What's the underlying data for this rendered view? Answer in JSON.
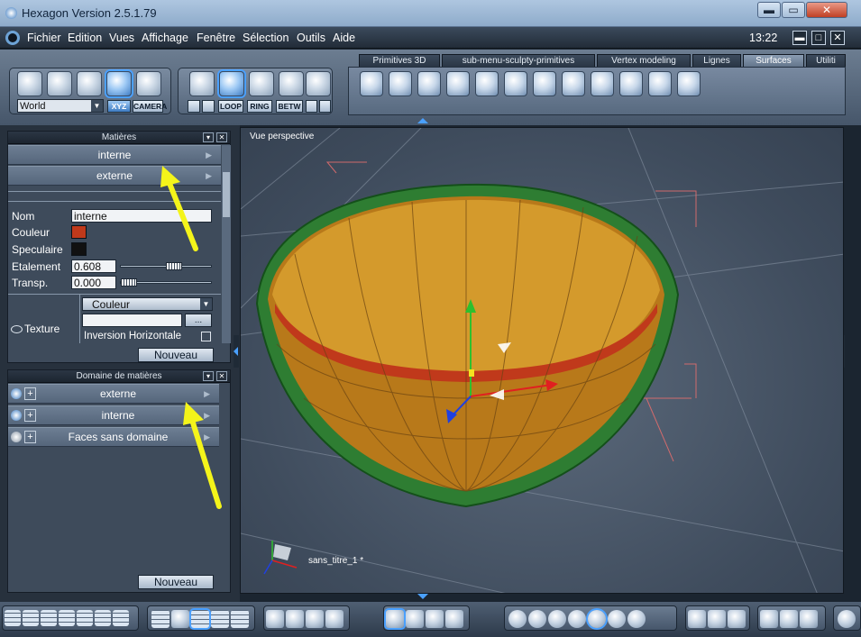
{
  "window": {
    "title": "Hexagon Version 2.5.1.79",
    "min": "▬",
    "max": "▭",
    "close": "✕"
  },
  "menu": {
    "items": [
      "Fichier",
      "Edition",
      "Vues",
      "Affichage",
      "Fenêtre",
      "Sélection",
      "Outils",
      "Aide"
    ],
    "clock": "13:22",
    "btn_min": "▬",
    "btn_max": "□",
    "btn_close": "✕"
  },
  "toolbar": {
    "coord_select": "World",
    "xyz": "XYZ",
    "camera": "CAMERA",
    "mesh_buttons": [
      "LOOP",
      "RING",
      "BETW"
    ]
  },
  "tabs": [
    {
      "label": "Primitives 3D",
      "selected": false
    },
    {
      "label": "sub-menu-sculpty-primitives",
      "selected": false
    },
    {
      "label": "Vertex modeling",
      "selected": false
    },
    {
      "label": "Lignes",
      "selected": false
    },
    {
      "label": "Surfaces",
      "selected": true
    },
    {
      "label": "Utiliti",
      "selected": false
    }
  ],
  "materials_panel": {
    "title": "Matières",
    "rows": [
      "interne",
      "externe"
    ],
    "labels": {
      "name": "Nom",
      "color": "Couleur",
      "specular": "Speculaire",
      "spread": "Etalement",
      "transp": "Transp.",
      "texture": "Texture"
    },
    "name_value": "interne",
    "color_value": "#c0391b",
    "specular_value": "#111111",
    "spread_value": "0.608",
    "spread_level": 0.608,
    "transp_value": "0.000",
    "transp_level": 0.0,
    "texture_select": "Couleur",
    "texture_btn": "...",
    "inversion_label": "Inversion Horizontale",
    "new_button": "Nouveau"
  },
  "domain_panel": {
    "title": "Domaine de matières",
    "rows": [
      "externe",
      "interne",
      "Faces sans domaine"
    ],
    "plus": "+",
    "new_button": "Nouveau"
  },
  "viewport": {
    "label": "Vue perspective",
    "object_name": "sans_titre_1 *",
    "colors": {
      "bowl_outer": "#2e7d32",
      "bowl_inner": "#c88a1a",
      "rim_band": "#c0391b"
    }
  }
}
